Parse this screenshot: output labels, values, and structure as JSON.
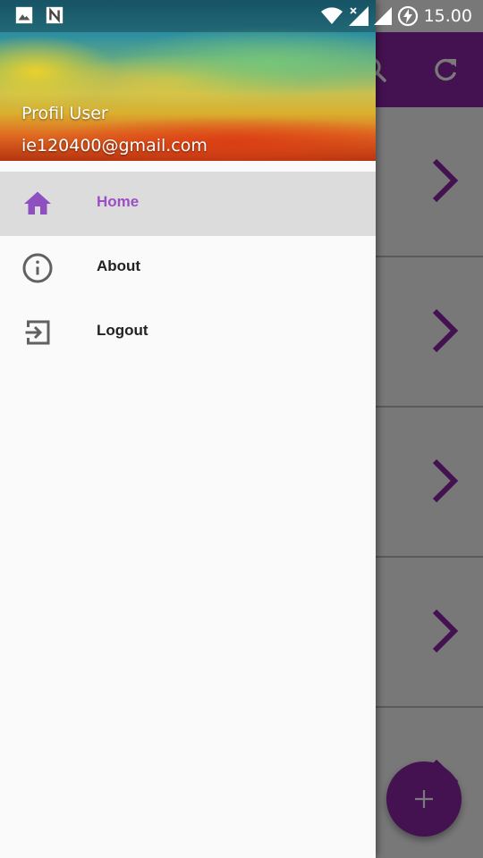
{
  "status_bar": {
    "time": "15.00",
    "left_icons": [
      "image-icon",
      "n-notification-icon"
    ],
    "right_icons": [
      "wifi-icon",
      "signal-no-data-icon",
      "signal-icon",
      "battery-charging-icon"
    ]
  },
  "drawer": {
    "header": {
      "name": "Profil User",
      "email": "ie120400@gmail.com"
    },
    "menu": [
      {
        "label": "Home",
        "icon": "home-icon",
        "selected": true
      },
      {
        "label": "About",
        "icon": "info-icon",
        "selected": false
      },
      {
        "label": "Logout",
        "icon": "exit-icon",
        "selected": false
      }
    ]
  },
  "background_app": {
    "toolbar_icons": [
      "search-icon",
      "refresh-icon"
    ],
    "list_row_count": 5,
    "fab_icon": "plus-icon"
  },
  "colors": {
    "accent": "#8e24aa",
    "selected_text": "#9c4fc4",
    "selected_bg": "#dcdcdc",
    "drawer_bg": "#fafafa"
  }
}
